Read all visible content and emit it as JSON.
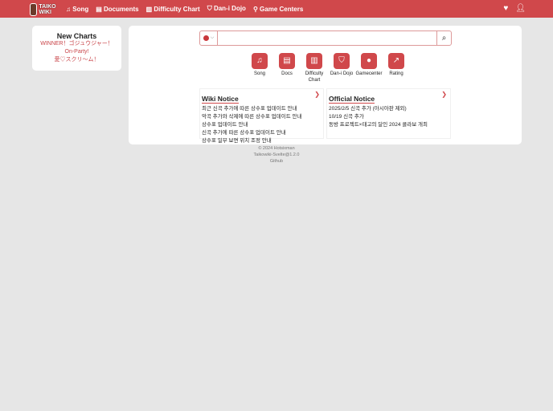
{
  "header": {
    "logo": "TAIKO WIKI",
    "nav": [
      "Song",
      "Documents",
      "Difficulty Chart",
      "Dan-i Dojo",
      "Game Centers"
    ]
  },
  "new_charts": {
    "title": "New Charts",
    "items": [
      "WINNER！ゴジュウジャー！",
      "On-Party!",
      "愛♡スクリ〜ム！"
    ]
  },
  "search": {
    "placeholder": ""
  },
  "quick_links": [
    {
      "label": "Song",
      "icon": "♫"
    },
    {
      "label": "Docs",
      "icon": "▤"
    },
    {
      "label": "Difficulty Chart",
      "icon": "▥"
    },
    {
      "label": "Dan-i Dojo",
      "icon": "⛉"
    },
    {
      "label": "Gamecenter",
      "icon": "●"
    },
    {
      "label": "Rating",
      "icon": "↗"
    }
  ],
  "wiki_notice": {
    "title": "Wiki Notice",
    "items": [
      "최근 신곡 추가에 따른 상수표 업데이트 안내",
      "악곡 추가와 삭제에 따른 상수표 업데이트 안내",
      "상수표 업데이트 안내",
      "신곡 추가에 따른 상수표 업데이트 안내",
      "상수표 일부 보면 위치 조정 안내"
    ]
  },
  "official_notice": {
    "title": "Official Notice",
    "items": [
      "2025/2/5 신곡 추가 (아시아판 제외)",
      "10/19 신곡 추가",
      "동방 프로젝트×태고의 달인 2024 콜라보 개최"
    ]
  },
  "footer": {
    "copyright": "© 2024 Hotsixman",
    "version": "Taikowiki-Svelte@1.2.0",
    "github": "Github"
  }
}
